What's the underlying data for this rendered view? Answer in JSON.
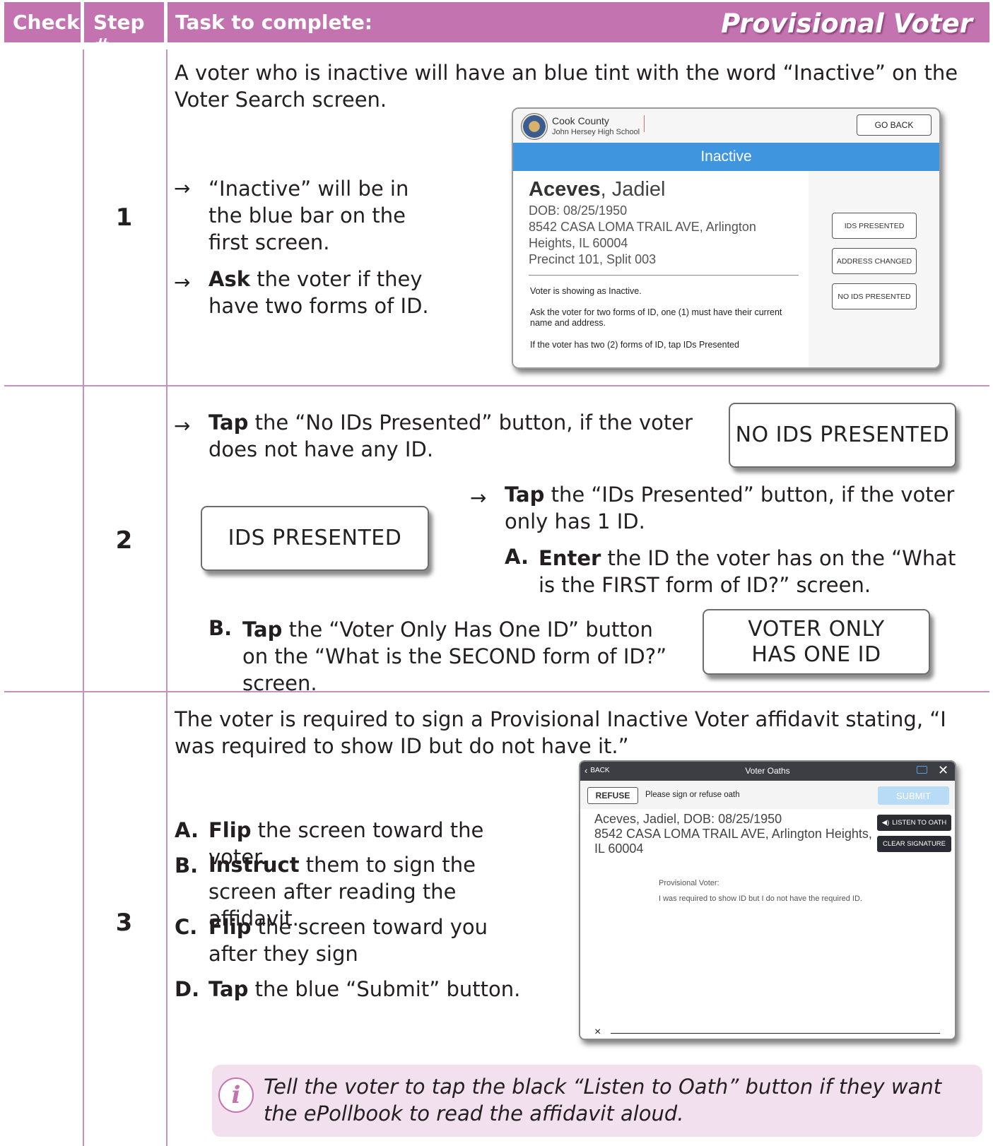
{
  "header": {
    "check": "Check",
    "step": "Step #",
    "task": "Task to complete:",
    "title": "Provisional Voter"
  },
  "step1": {
    "number": "1",
    "intro": "A voter who is inactive will have an blue tint with the word “Inactive” on the Voter Search screen.",
    "bullet1": "“Inactive” will be in the blue bar on the first screen.",
    "bullet2_bold": "Ask",
    "bullet2_rest": " the voter if they have two forms of ID.",
    "screen": {
      "county": "Cook County",
      "school": "John Hersey High School",
      "go_back": "GO BACK",
      "status_bar": "Inactive",
      "last_name": "Aceves",
      "first_name": ", Jadiel",
      "dob": "DOB: 08/25/1950",
      "address_line1": "8542 CASA LOMA TRAIL AVE, Arlington",
      "address_line2": "Heights, IL 60004",
      "precinct": "Precinct 101, Split 003",
      "msg1": "Voter is showing as Inactive.",
      "msg2": "Ask the voter for two forms of ID, one (1) must have their current name and address.",
      "msg3": "If the voter has two (2) forms of ID, tap IDs Presented",
      "btn_ids": "IDS PRESENTED",
      "btn_address": "ADDRESS CHANGED",
      "btn_no_ids": "NO IDS PRESENTED"
    }
  },
  "step2": {
    "number": "2",
    "a_bold": "Tap",
    "a_rest": " the “No IDs Presented” button, if the voter does not have any ID.",
    "btn_no_ids": "NO IDS PRESENTED",
    "btn_ids": "IDS PRESENTED",
    "b_bold": "Tap",
    "b_rest": " the “IDs Presented” button, if the voter only has 1 ID.",
    "sub_a_label": "A.",
    "sub_a_bold": "Enter",
    "sub_a_rest": " the ID the voter has on the “What is the FIRST form of ID?” screen.",
    "sub_b_label": "B.",
    "sub_b_bold": "Tap",
    "sub_b_rest": " the “Voter Only Has One ID” button on the “What is the SECOND form of ID?” screen.",
    "btn_one_id": "VOTER ONLY HAS ONE ID"
  },
  "step3": {
    "number": "3",
    "intro": "The voter is required to sign a Provisional Inactive Voter affidavit stating, “I was required to show ID but do not have it.”",
    "items": [
      {
        "label": "A.",
        "bold": "Flip",
        "rest": " the screen toward the voter."
      },
      {
        "label": "B.",
        "bold": "Instruct",
        "rest": " them to sign the screen after reading the affidavit."
      },
      {
        "label": "C.",
        "bold": "Flip",
        "rest": " the screen toward you after they sign"
      },
      {
        "label": "D.",
        "bold": "Tap",
        "rest": " the blue “Submit” button."
      }
    ],
    "screen": {
      "back": "BACK",
      "title": "Voter Oaths",
      "close": "✕",
      "refuse": "REFUSE",
      "prompt": "Please sign or refuse oath",
      "submit": "SUBMIT",
      "voter_line1": "Aceves, Jadiel, DOB: 08/25/1950",
      "voter_line2": "8542 CASA LOMA TRAIL AVE, Arlington Heights,",
      "voter_line3": "IL 60004",
      "listen": "LISTEN TO OATH",
      "clear": "CLEAR SIGNATURE",
      "oath_label": "Provisional Voter:",
      "oath_text": "I was required to show ID but I do not have the required ID.",
      "sign_x": "×"
    }
  },
  "note": {
    "text": "Tell the voter to tap the black “Listen to Oath” button if they want the ePollbook to read the affidavit aloud."
  },
  "colors": {
    "header": "#c374b0",
    "rule": "#c98fc0",
    "inactive_bar": "#3f96df",
    "note_bg": "#f3e0ee"
  }
}
